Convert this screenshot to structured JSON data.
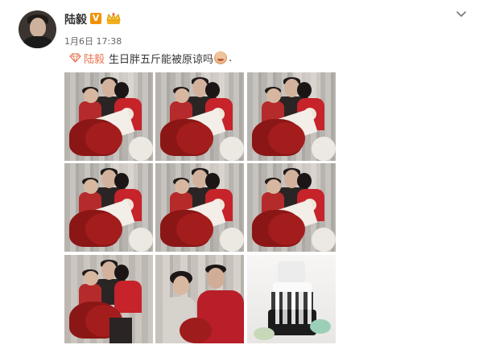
{
  "user": {
    "name": "陆毅",
    "verified_badge": "V",
    "crown_icon": "crown-icon"
  },
  "post": {
    "timestamp": "1月6日 17:38",
    "mention": "陆毅",
    "text": "生日胖五斤能被原谅吗",
    "trailing": ".",
    "emoji_icon": "laughing-face-emoji-icon"
  },
  "menu": {
    "icon": "chevron-down-icon"
  },
  "photos": [
    {
      "label": "photo-1"
    },
    {
      "label": "photo-2"
    },
    {
      "label": "photo-3"
    },
    {
      "label": "photo-4"
    },
    {
      "label": "photo-5"
    },
    {
      "label": "photo-6"
    },
    {
      "label": "photo-7"
    },
    {
      "label": "photo-8"
    },
    {
      "label": "photo-9"
    }
  ],
  "colors": {
    "mention": "#eb7350",
    "badge": "#f29100"
  }
}
